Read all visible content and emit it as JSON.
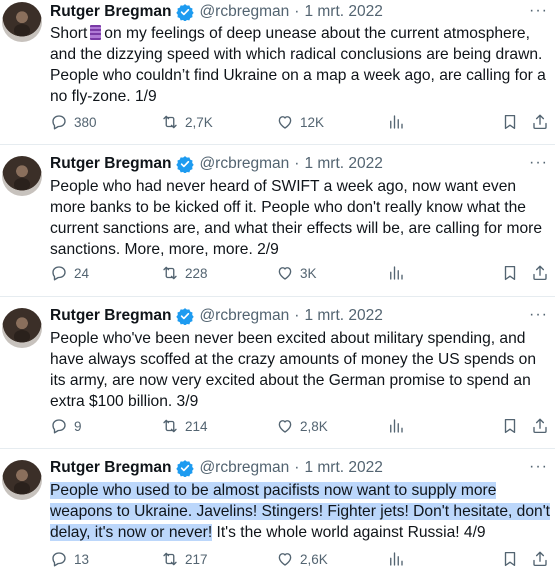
{
  "tweets": [
    {
      "author": "Rutger Bregman",
      "handle": "@rcbregman",
      "separator": "·",
      "date": "1 mrt. 2022",
      "text_before_emoji": "Short",
      "text_after_emoji": "on my feelings of deep unease about the current atmosphere, and the dizzying speed with which radical conclusions are being drawn. People who couldn’t find Ukraine on a map a week ago, are calling for a no fly-zone. 1/9",
      "emoji": "thread-spool-icon",
      "replies": "380",
      "retweets": "2,7K",
      "likes": "12K"
    },
    {
      "author": "Rutger Bregman",
      "handle": "@rcbregman",
      "separator": "·",
      "date": "1 mrt. 2022",
      "text": "People who had never heard of SWIFT a week ago, now want even more banks to be kicked off it. People who don't really know what the current sanctions are, and what their effects will be, are calling for more sanctions. More, more, more. 2/9",
      "replies": "24",
      "retweets": "228",
      "likes": "3K"
    },
    {
      "author": "Rutger Bregman",
      "handle": "@rcbregman",
      "separator": "·",
      "date": "1 mrt. 2022",
      "text": "People who've been never been excited about military spending, and have always scoffed at the crazy amounts of money the US spends on its army, are now very excited about the German promise to spend an extra $100 billion. 3/9",
      "replies": "9",
      "retweets": "214",
      "likes": "2,8K"
    },
    {
      "author": "Rutger Bregman",
      "handle": "@rcbregman",
      "separator": "·",
      "date": "1 mrt. 2022",
      "text_highlighted": "People who used to be almost pacifists now want to  supply more weapons to Ukraine. Javelins! Stingers! Fighter jets! Don't hesitate, don't delay, it's now or never!",
      "text_rest": " It's the whole world against Russia! 4/9",
      "replies": "13",
      "retweets": "217",
      "likes": "2,6K"
    }
  ],
  "more_label": "···",
  "icons": [
    "verified-badge-icon",
    "reply-icon",
    "retweet-icon",
    "like-icon",
    "views-icon",
    "bookmark-icon",
    "share-icon",
    "more-icon"
  ],
  "colors": {
    "verified": "#1d9bf0",
    "secondary_text": "#536471",
    "highlight": "#bcd7fb"
  }
}
